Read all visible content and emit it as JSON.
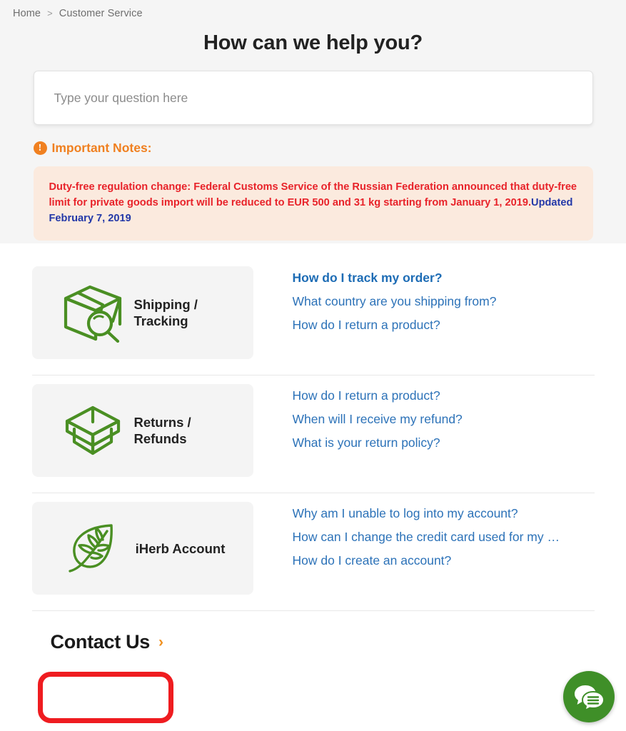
{
  "breadcrumb": {
    "home": "Home",
    "separator": ">",
    "current": "Customer Service"
  },
  "hero": {
    "title": "How can we help you?",
    "search_placeholder": "Type your question here",
    "search_value": ""
  },
  "notes": {
    "icon": "warning-exclamation-icon",
    "glyph": "!",
    "title": "Important Notes:",
    "body": "Duty-free regulation change: Federal Customs Service of the Russian Federation announced that duty-free limit for private goods import will be reduced to EUR 500 and 31 kg starting from January 1, 2019.",
    "updated": "Updated February 7, 2019"
  },
  "topics": [
    {
      "icon": "package-search-icon",
      "label": "Shipping / Tracking",
      "links": [
        {
          "text": "How do I track my order?",
          "emphasis": true
        },
        {
          "text": "What country are you shipping from?",
          "emphasis": false
        },
        {
          "text": "How do I return a product?",
          "emphasis": false
        }
      ]
    },
    {
      "icon": "open-box-icon",
      "label": "Returns / Refunds",
      "links": [
        {
          "text": "How do I return a product?",
          "emphasis": false
        },
        {
          "text": "When will I receive my refund?",
          "emphasis": false
        },
        {
          "text": "What is your return policy?",
          "emphasis": false
        }
      ]
    },
    {
      "icon": "leaf-icon",
      "label": "iHerb Account",
      "links": [
        {
          "text": "Why am I unable to log into my account?",
          "emphasis": false
        },
        {
          "text": "How can I change the credit card used for my o…",
          "emphasis": false
        },
        {
          "text": "How do I create an account?",
          "emphasis": false
        }
      ]
    }
  ],
  "contact": {
    "label": "Contact Us",
    "chevron": "›"
  },
  "chat": {
    "icon": "chat-bubbles-icon"
  },
  "colors": {
    "hero_bg": "#f5f5f5",
    "notice_bg": "#fbeade",
    "notice_text": "#e8232a",
    "notice_updated": "#2338a8",
    "accent_orange": "#f08020",
    "link_blue": "#2c72b8",
    "icon_green": "#4a8f23",
    "chat_green": "#3f8f28",
    "highlight_red": "#ef1c20",
    "card_bg": "#f4f4f4"
  }
}
